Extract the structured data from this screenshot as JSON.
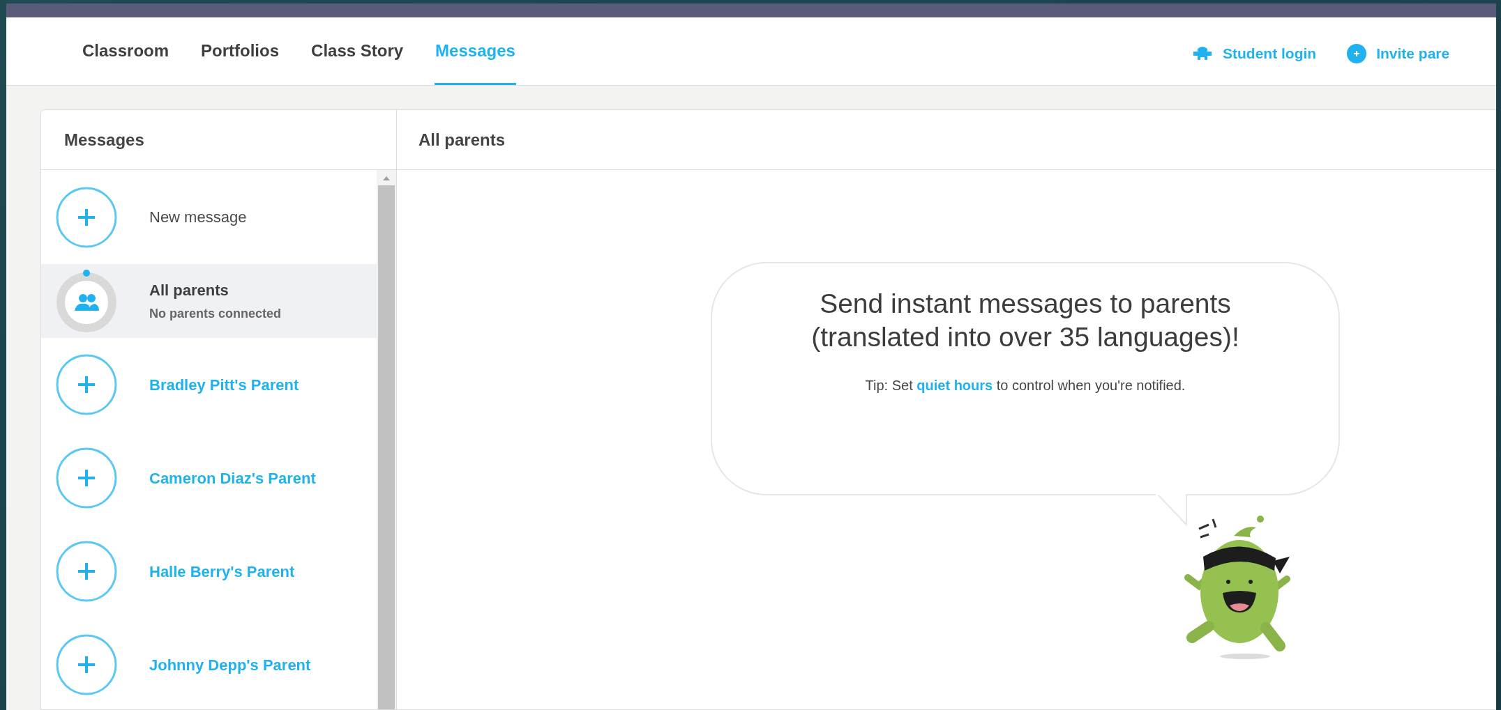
{
  "nav": {
    "tabs": [
      {
        "label": "Classroom",
        "selected": false
      },
      {
        "label": "Portfolios",
        "selected": false
      },
      {
        "label": "Class Story",
        "selected": false
      },
      {
        "label": "Messages",
        "selected": true
      }
    ],
    "actions": [
      {
        "kind": "student",
        "label": "Student login"
      },
      {
        "kind": "invite",
        "label": "Invite pare"
      }
    ]
  },
  "sidebar": {
    "title": "Messages",
    "items": [
      {
        "kind": "new",
        "label": "New message",
        "selected": false
      },
      {
        "kind": "group",
        "label": "All parents",
        "subtitle": "No parents connected",
        "selected": true
      },
      {
        "kind": "parent",
        "label": "Bradley Pitt's Parent",
        "selected": false
      },
      {
        "kind": "parent",
        "label": "Cameron Diaz's Parent",
        "selected": false
      },
      {
        "kind": "parent",
        "label": "Halle Berry's Parent",
        "selected": false
      },
      {
        "kind": "parent",
        "label": "Johnny Depp's Parent",
        "selected": false
      }
    ]
  },
  "conversation": {
    "title": "All parents",
    "bubble": {
      "headline": "Send instant messages to parents (translated into over 35 languages)!",
      "tip_before": "Tip: Set ",
      "tip_link": "quiet hours",
      "tip_after": " to control when you're notified."
    }
  }
}
